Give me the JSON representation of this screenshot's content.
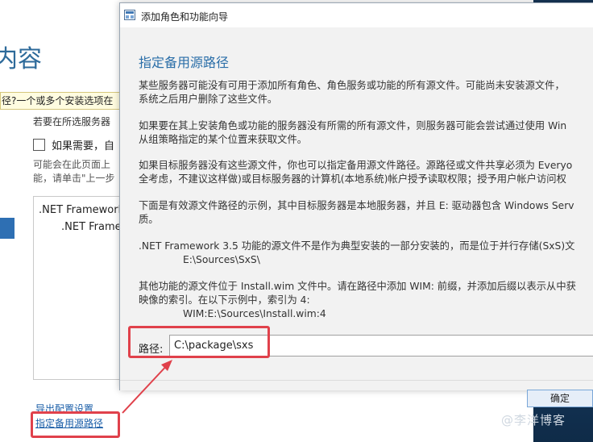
{
  "background_wizard": {
    "title": "内容",
    "warning_text": "径?一个或多个安装选项在",
    "info_line": "若要在所选服务器",
    "checkbox_label": "如果需要，自",
    "note_line1": "可能会在此页面上",
    "note_line2": "能，请单击\"上一步",
    "features": [
      ".NET Framework",
      ".NET Frame"
    ],
    "export_link": "导出配置设置",
    "alt_source_link": "指定备用源路径"
  },
  "dialog": {
    "title": "添加角色和功能向导",
    "heading": "指定备用源路径",
    "paragraphs": {
      "p1_line1": "某些服务器可能没有可用于添加所有角色、角色服务或功能的所有源文件。可能尚未安装源文件，",
      "p1_line2": "系统之后用户删除了这些文件。",
      "p2_line1": "如果要在其上安装角色或功能的服务器没有所需的所有源文件，则服务器可能会尝试通过使用 Win",
      "p2_line2": "从组策略指定的某个位置来获取文件。",
      "p3_line1": "如果目标服务器没有这些源文件，你也可以指定备用源文件路径。源路径或文件共享必须为 Everyo",
      "p3_line2": "全考虑，不建议这样做)或目标服务器的计算机(本地系统)帐户授予读取权限；授予用户帐户访问权",
      "p4_line1": "下面是有效源文件路径的示例，其中目标服务器是本地服务器，并且 E: 驱动器包含 Windows Serv",
      "p4_line2": "质。",
      "p5_line1": ".NET Framework 3.5 功能的源文件不是作为典型安装的一部分安装的，而是位于并行存储(SxS)文",
      "p5_line2": "E:\\Sources\\SxS\\",
      "p6_line1": "其他功能的源文件位于 Install.wim 文件中。请在路径中添加 WIM: 前缀，并添加后缀以表示从中获",
      "p6_line2": "映像的索引。在以下示例中，索引为 4:",
      "p6_line3": "WIM:E:\\Sources\\Install.wim:4"
    },
    "path_label": "路径:",
    "path_value": "C:\\package\\sxs",
    "ok_button": "确定"
  },
  "watermark": "@李洋博客",
  "colors": {
    "heading": "#2a6ea8",
    "highlight": "#e0414b",
    "link": "#1a5ea8",
    "desktop": "#1f3f66"
  }
}
